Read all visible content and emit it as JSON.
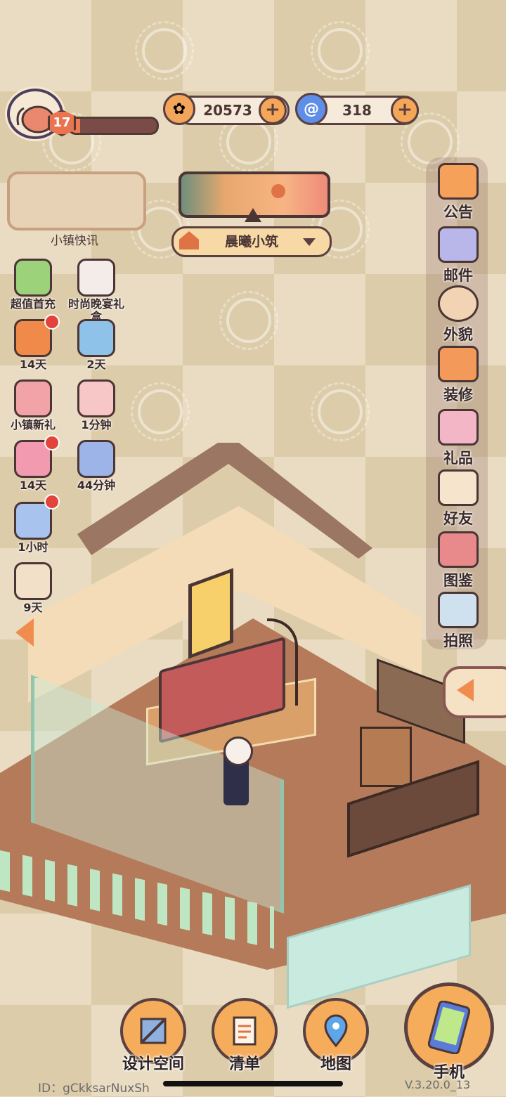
{
  "player": {
    "level": "17",
    "exp_fraction": 0.12
  },
  "currency": {
    "coins": {
      "value": "20573",
      "icon": "coin-icon"
    },
    "gems": {
      "value": "318",
      "icon": "swirl-gem-icon"
    }
  },
  "news": {
    "label": "小镇快讯"
  },
  "location": {
    "name": "晨曦小筑"
  },
  "events": [
    {
      "label": "超值首充"
    },
    {
      "label": "时尚晚宴礼盒"
    },
    {
      "label": "14天"
    },
    {
      "label": "2天"
    },
    {
      "label": "小镇新礼"
    },
    {
      "label": "1分钟"
    },
    {
      "label": "14天"
    },
    {
      "label": "44分钟"
    },
    {
      "label": "1小时"
    },
    {
      "label": "9天"
    }
  ],
  "menu": [
    {
      "label": "公告",
      "icon": "megaphone-icon"
    },
    {
      "label": "邮件",
      "icon": "mail-icon"
    },
    {
      "label": "外貌",
      "icon": "character-icon"
    },
    {
      "label": "装修",
      "icon": "house-wrench-icon"
    },
    {
      "label": "礼品",
      "icon": "gift-icon"
    },
    {
      "label": "好友",
      "icon": "contacts-icon"
    },
    {
      "label": "图鉴",
      "icon": "album-icon"
    },
    {
      "label": "拍照",
      "icon": "camera-icon"
    }
  ],
  "bottom": {
    "design": "设计空间",
    "list": "清单",
    "map": "地图",
    "phone": "手机"
  },
  "footer": {
    "id": "ID：gCkksarNuxSh",
    "version": "V.3.20.0_13"
  },
  "colors": {
    "accent": "#f5ad5c",
    "outline": "#5a4040",
    "badge": "#e2443b"
  }
}
